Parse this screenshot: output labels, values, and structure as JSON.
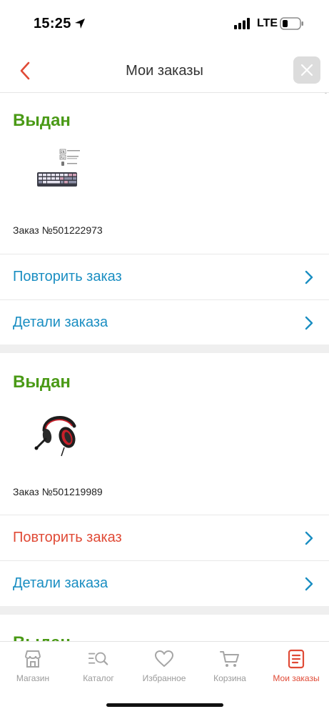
{
  "status_bar": {
    "time": "15:25",
    "network": "LTE"
  },
  "header": {
    "title": "Мои заказы"
  },
  "orders": [
    {
      "status": "Выдан",
      "number": "Заказ №501222973",
      "thumb_icon": "keyboard-product-image",
      "repeat_label": "Повторить заказ",
      "details_label": "Детали заказа"
    },
    {
      "status": "Выдан",
      "number": "Заказ №501219989",
      "thumb_icon": "headset-product-image",
      "repeat_label": "Повторить заказ",
      "details_label": "Детали заказа"
    },
    {
      "status": "Выдан"
    }
  ],
  "tabbar": {
    "items": [
      {
        "label": "Магазин",
        "icon": "store-icon"
      },
      {
        "label": "Каталог",
        "icon": "catalog-search-icon"
      },
      {
        "label": "Избранное",
        "icon": "heart-icon"
      },
      {
        "label": "Корзина",
        "icon": "cart-icon"
      },
      {
        "label": "Мои заказы",
        "icon": "orders-icon",
        "active": true
      }
    ]
  },
  "colors": {
    "accent_red": "#e04a36",
    "link_blue": "#1a8ec2",
    "status_green": "#4a9a16"
  }
}
